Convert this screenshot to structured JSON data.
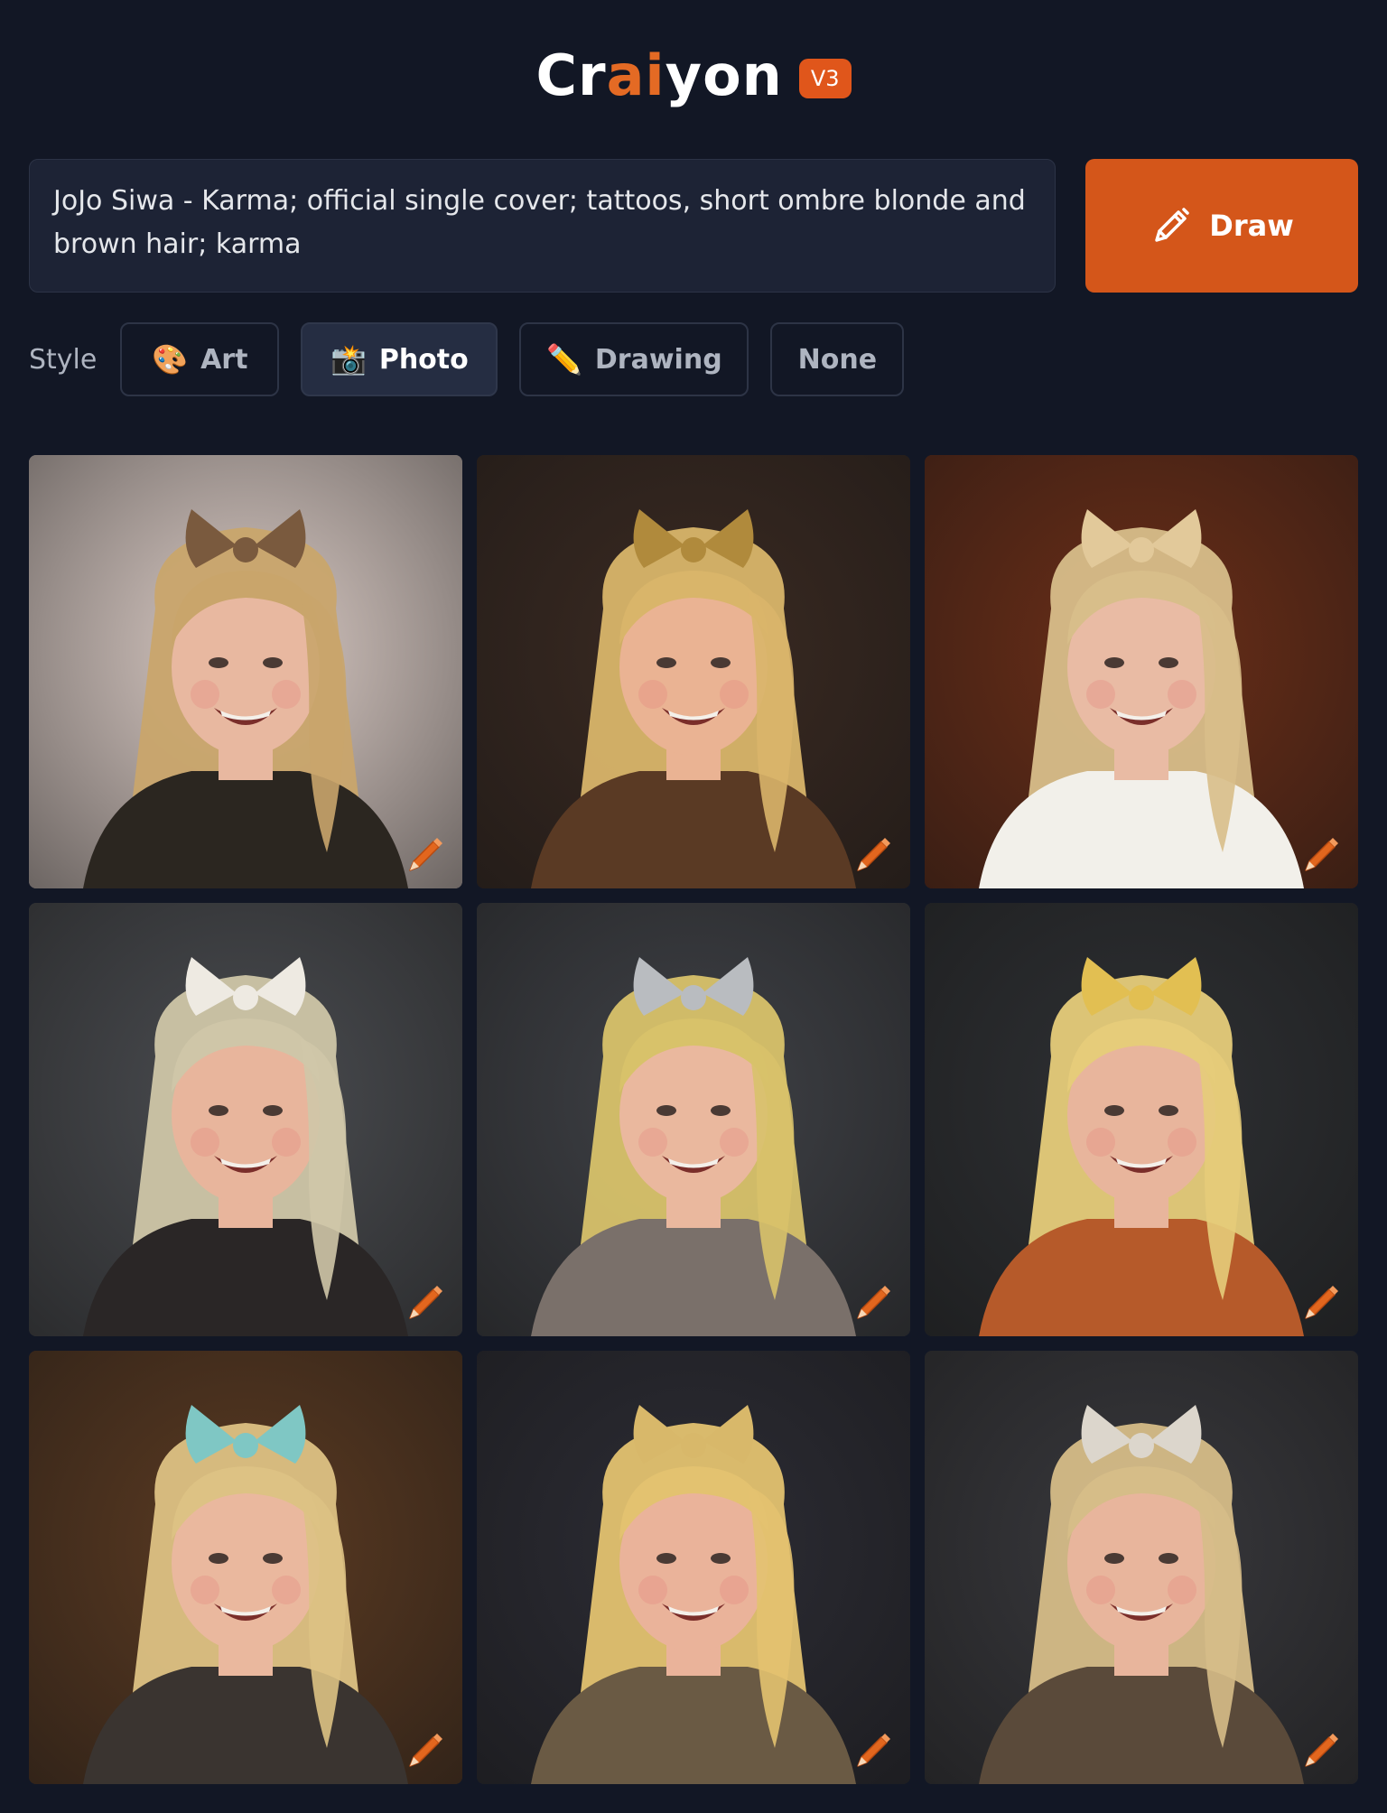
{
  "header": {
    "logo_part1": "Cr",
    "logo_part2": "ai",
    "logo_part3": "yon",
    "version": "V3"
  },
  "prompt": {
    "value": "JoJo Siwa - Karma; official single cover; tattoos, short ombre blonde and brown hair; karma"
  },
  "draw_button": {
    "label": "Draw",
    "icon": "pencil-icon"
  },
  "style": {
    "label": "Style",
    "options": [
      {
        "label": "Art",
        "emoji": "🎨",
        "active": false
      },
      {
        "label": "Photo",
        "emoji": "📸",
        "active": true
      },
      {
        "label": "Drawing",
        "emoji": "✏️",
        "active": false
      },
      {
        "label": "None",
        "emoji": "",
        "active": false
      }
    ]
  },
  "results": {
    "tiles": [
      {
        "bg": "#d8c9c3",
        "hair": "#c9a56b",
        "skin": "#e8b8a0",
        "bow": "#7a5a3e",
        "shirt": "#2b2620"
      },
      {
        "bg": "#3a2a22",
        "hair": "#d9b56a",
        "skin": "#eab393",
        "bow": "#b08a3c",
        "shirt": "#5a3a24"
      },
      {
        "bg": "#6a2e18",
        "hair": "#d8be8a",
        "skin": "#e9bba4",
        "bow": "#e2c99a",
        "shirt": "#f2f0ea"
      },
      {
        "bg": "#4a4c50",
        "hair": "#cfc6a8",
        "skin": "#e8b59c",
        "bow": "#eeeae2",
        "shirt": "#2a2626"
      },
      {
        "bg": "#3f4146",
        "hair": "#d8c26a",
        "skin": "#eab89e",
        "bow": "#b9bcc0",
        "shirt": "#7a706a"
      },
      {
        "bg": "#2e3033",
        "hair": "#e6cc7a",
        "skin": "#e8b59c",
        "bow": "#e2bf52",
        "shirt": "#b65a2a"
      },
      {
        "bg": "#5a3a22",
        "hair": "#ddc284",
        "skin": "#eab89e",
        "bow": "#7fc7c4",
        "shirt": "#3a3430"
      },
      {
        "bg": "#2c2c34",
        "hair": "#e3c270",
        "skin": "#eab39a",
        "bow": "#d8b86a",
        "shirt": "#6a5a44"
      },
      {
        "bg": "#38383c",
        "hair": "#d6bd88",
        "skin": "#e8b59c",
        "bow": "#dcd6cc",
        "shirt": "#5a4a3a"
      }
    ]
  },
  "colors": {
    "background": "#121725",
    "accent": "#d4561a"
  }
}
